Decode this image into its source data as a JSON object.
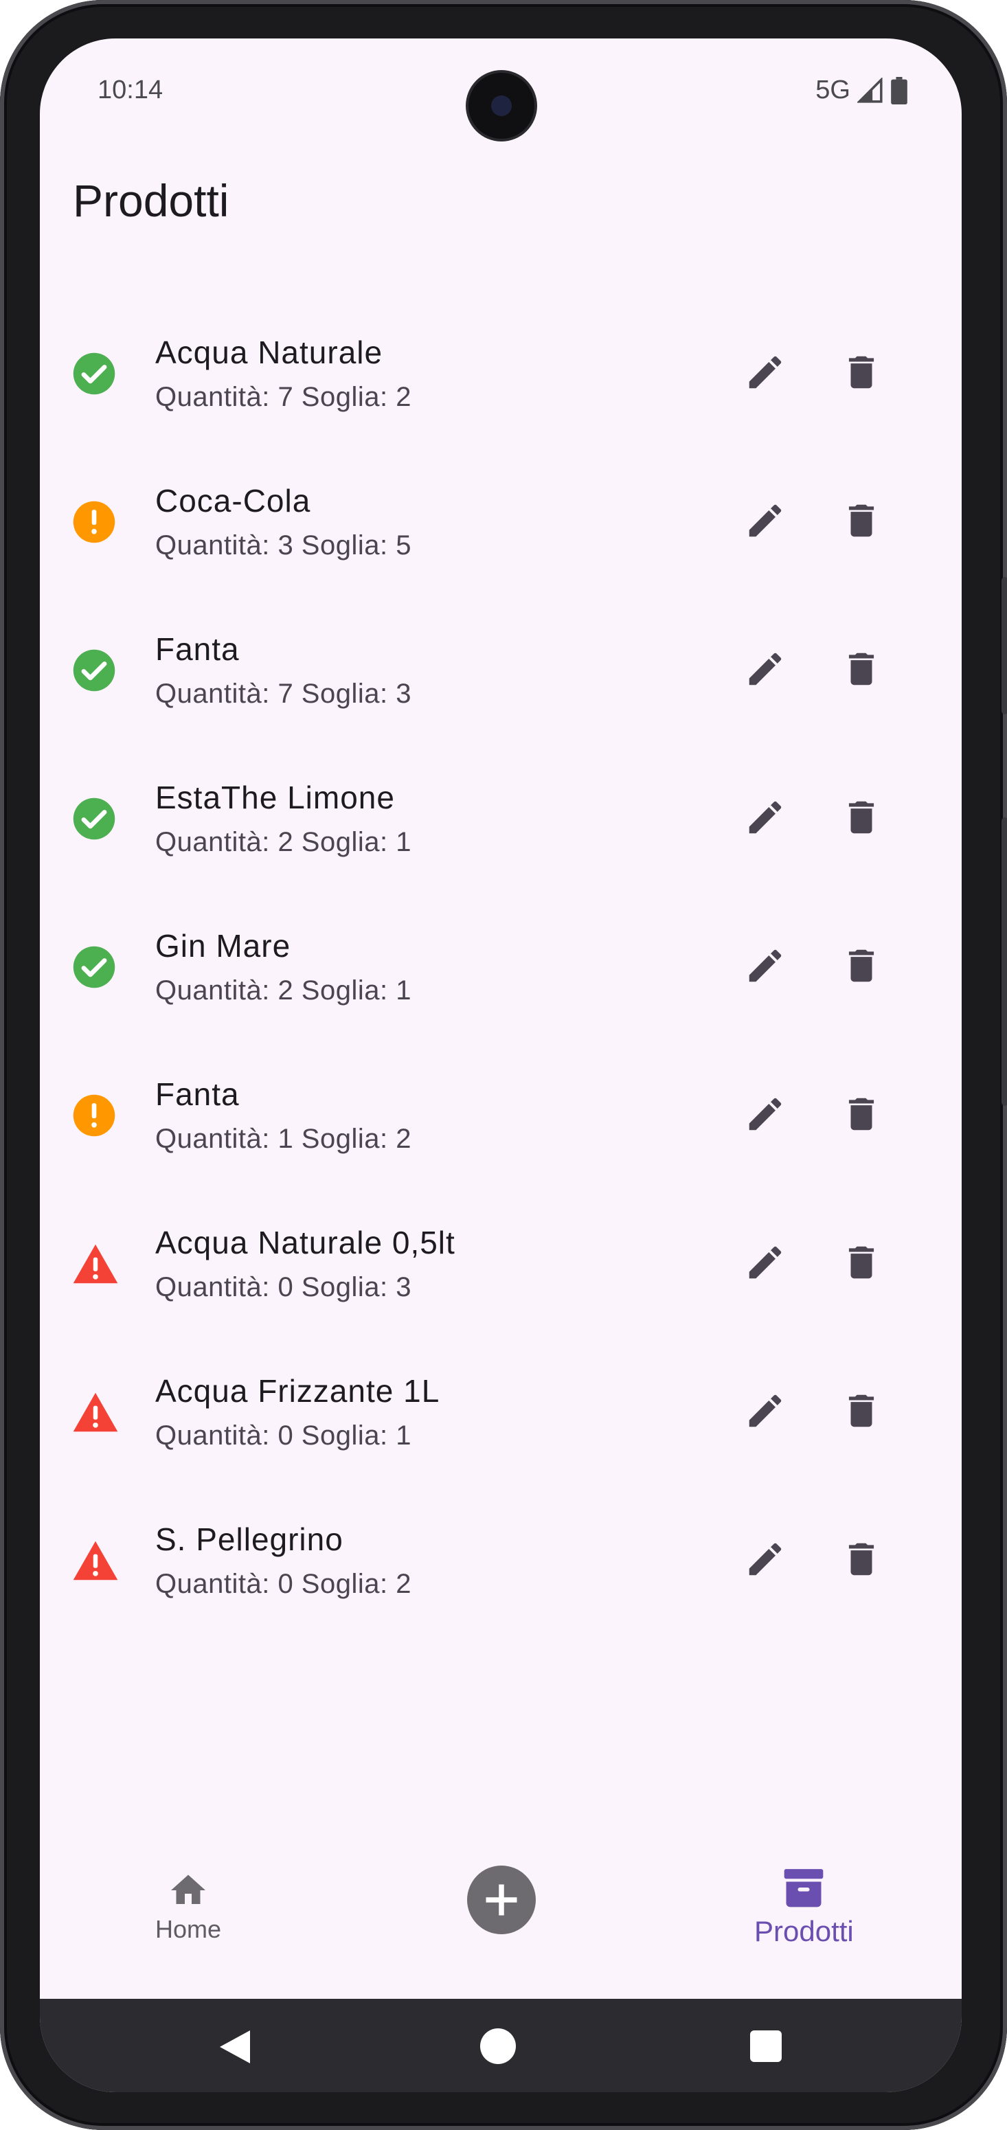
{
  "status_bar": {
    "time": "10:14",
    "network": "5G"
  },
  "page": {
    "title": "Prodotti"
  },
  "products": [
    {
      "name": "Acqua Naturale",
      "details": "Quantità: 7 Soglia: 2",
      "status": "ok"
    },
    {
      "name": "Coca-Cola",
      "details": "Quantità: 3 Soglia: 5",
      "status": "low"
    },
    {
      "name": "Fanta",
      "details": "Quantità: 7 Soglia: 3",
      "status": "ok"
    },
    {
      "name": "EstaThe Limone",
      "details": "Quantità: 2 Soglia: 1",
      "status": "ok"
    },
    {
      "name": "Gin Mare",
      "details": "Quantità: 2 Soglia: 1",
      "status": "ok"
    },
    {
      "name": "Fanta",
      "details": "Quantità: 1 Soglia: 2",
      "status": "low"
    },
    {
      "name": "Acqua Naturale 0,5lt",
      "details": "Quantità: 0 Soglia: 3",
      "status": "out"
    },
    {
      "name": "Acqua Frizzante 1L",
      "details": "Quantità: 0 Soglia: 1",
      "status": "out"
    },
    {
      "name": "S. Pellegrino",
      "details": "Quantità: 0 Soglia: 2",
      "status": "out"
    }
  ],
  "icons": {
    "ok": "check-circle-icon",
    "low": "exclamation-circle-icon",
    "out": "warning-triangle-icon",
    "edit": "pencil-icon",
    "delete": "trash-icon"
  },
  "colors": {
    "ok": "#4caf50",
    "low": "#ff9800",
    "out": "#f44336",
    "accent": "#6a4fb0",
    "background": "#fcf4fc"
  },
  "bottom_nav": {
    "home_label": "Home",
    "products_label": "Prodotti",
    "active": "Prodotti"
  }
}
